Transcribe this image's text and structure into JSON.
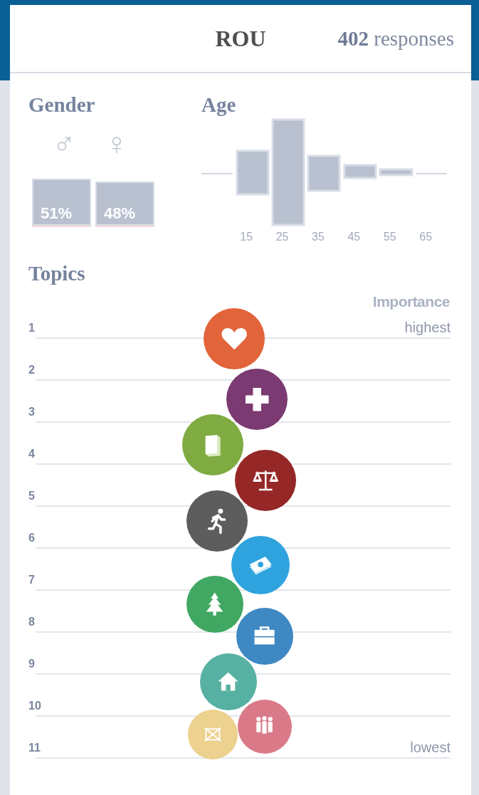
{
  "header": {
    "country": "ROU",
    "response_count": "402",
    "response_label": "responses"
  },
  "gender": {
    "title": "Gender",
    "groups": [
      {
        "symbol": "♂",
        "label": "51%",
        "level": 0.51
      },
      {
        "symbol": "♀",
        "label": "48%",
        "level": 0.48
      }
    ]
  },
  "age": {
    "title": "Age",
    "tick_labels": [
      "15",
      "25",
      "35",
      "45",
      "55",
      "65"
    ]
  },
  "topics": {
    "title": "Topics",
    "importance_label": "Importance",
    "highest_label": "highest",
    "lowest_label": "lowest",
    "ranks": [
      "1",
      "2",
      "3",
      "4",
      "5",
      "6",
      "7",
      "8",
      "9",
      "10",
      "11"
    ],
    "items": [
      {
        "kind": "heart",
        "color": "#e2643a"
      },
      {
        "kind": "cross",
        "color": "#7b3a72"
      },
      {
        "kind": "book",
        "color": "#7fab42"
      },
      {
        "kind": "scales",
        "color": "#952727"
      },
      {
        "kind": "runner",
        "color": "#5d5d5d"
      },
      {
        "kind": "money",
        "color": "#2ea3de"
      },
      {
        "kind": "tree",
        "color": "#40a862"
      },
      {
        "kind": "briefcase",
        "color": "#3e88c4"
      },
      {
        "kind": "house",
        "color": "#57b1a3"
      },
      {
        "kind": "crossed-box",
        "color": "#ecd18f"
      },
      {
        "kind": "people",
        "color": "#da7a88"
      }
    ]
  }
}
